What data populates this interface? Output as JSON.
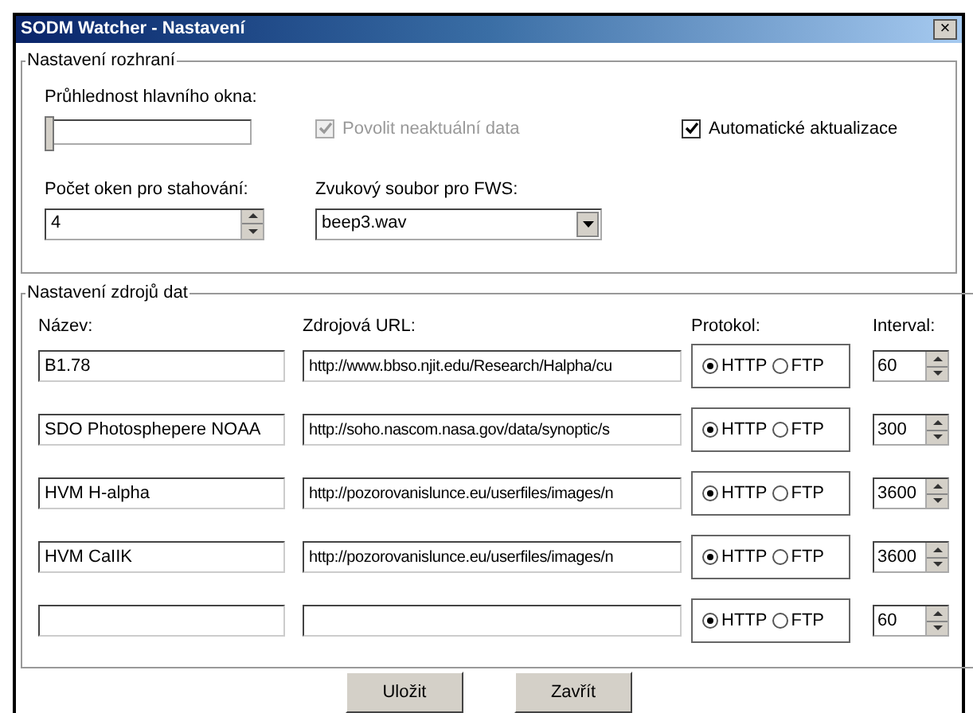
{
  "window": {
    "title": "SODM Watcher - Nastavení",
    "close": "×"
  },
  "interface": {
    "legend": "Nastavení rozhraní",
    "opacity_label": "Průhlednost hlavního okna:",
    "opacity": {
      "level": 0
    },
    "stale_data": {
      "label": "Povolit neaktuální data",
      "checked": true,
      "disabled": true
    },
    "auto_update": {
      "label": "Automatické aktualizace",
      "checked": true,
      "disabled": false
    },
    "window_count_label": "Počet oken pro stahování:",
    "window_count": "4",
    "sound_label": "Zvukový soubor pro FWS:",
    "sound": "beep3.wav"
  },
  "sources": {
    "legend": "Nastavení zdrojů dat",
    "columns": [
      "Název:",
      "Zdrojová URL:",
      "Protokol:",
      "Interval:"
    ],
    "rows": [
      {
        "name": "B1.78",
        "url": "http://www.bbso.njit.edu/Research/Halpha/cu",
        "protocols": [
          {
            "label": "HTTP",
            "selected": true
          },
          {
            "label": "FTP",
            "selected": false
          }
        ],
        "interval": "60"
      },
      {
        "name": "SDO Photosphepere NOAA",
        "url": "http://soho.nascom.nasa.gov/data/synoptic/s",
        "protocols": [
          {
            "label": "HTTP",
            "selected": true
          },
          {
            "label": "FTP",
            "selected": false
          }
        ],
        "interval": "300"
      },
      {
        "name": "HVM H-alpha",
        "url": "http://pozorovanislunce.eu/userfiles/images/n",
        "protocols": [
          {
            "label": "HTTP",
            "selected": true
          },
          {
            "label": "FTP",
            "selected": false
          }
        ],
        "interval": "3600"
      },
      {
        "name": "HVM CaIIK",
        "url": "http://pozorovanislunce.eu/userfiles/images/n",
        "protocols": [
          {
            "label": "HTTP",
            "selected": true
          },
          {
            "label": "FTP",
            "selected": false
          }
        ],
        "interval": "3600"
      },
      {
        "name": "",
        "url": "",
        "protocols": [
          {
            "label": "HTTP",
            "selected": true
          },
          {
            "label": "FTP",
            "selected": false
          }
        ],
        "interval": "60"
      }
    ]
  },
  "buttons": [
    "Uložit",
    "Zavřít"
  ]
}
